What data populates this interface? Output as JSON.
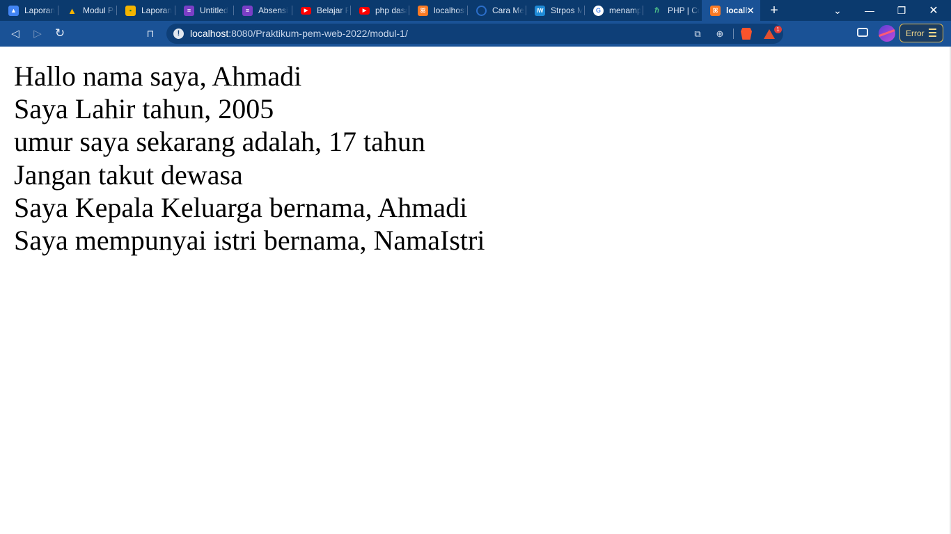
{
  "browser": {
    "tabs": [
      {
        "title": "Laporan",
        "icon": "classroom-icon",
        "color": "#4285f4"
      },
      {
        "title": "Modul Pe",
        "icon": "drive-icon",
        "color": "#f4b400"
      },
      {
        "title": "Laporan",
        "icon": "classroom-icon",
        "color": "#f4b400"
      },
      {
        "title": "Untitled",
        "icon": "form-icon",
        "color": "#7b3fc6"
      },
      {
        "title": "Absensi",
        "icon": "form-icon",
        "color": "#7b3fc6"
      },
      {
        "title": "Belajar P",
        "icon": "youtube-icon",
        "color": "#ff0000"
      },
      {
        "title": "php dasa",
        "icon": "youtube-icon",
        "color": "#ff0000"
      },
      {
        "title": "localhost",
        "icon": "xampp-icon",
        "color": "#fb7a24"
      },
      {
        "title": "Cara Mer",
        "icon": "site-icon",
        "color": "#2b6ec9"
      },
      {
        "title": "Strpos M",
        "icon": "site-icon",
        "color": "#1e8ad6"
      },
      {
        "title": "menamp",
        "icon": "google-icon",
        "color": "#ffffff"
      },
      {
        "title": "PHP | Co",
        "icon": "site-icon",
        "color": "#2e8b57"
      },
      {
        "title": "localh",
        "icon": "xampp-icon",
        "color": "#fb7a24",
        "active": true
      }
    ],
    "address": {
      "host": "localhost",
      "path": ":8080/Praktikum-pem-web-2022/modul-1/"
    },
    "brave_badge": "1",
    "error_label": "Error"
  },
  "page": {
    "lines": [
      "Hallo nama saya, Ahmadi",
      "Saya Lahir tahun, 2005",
      "umur saya sekarang adalah, 17 tahun",
      "Jangan takut dewasa",
      "Saya Kepala Keluarga bernama, Ahmadi",
      "Saya mempunyai istri bernama, NamaIstri"
    ]
  }
}
